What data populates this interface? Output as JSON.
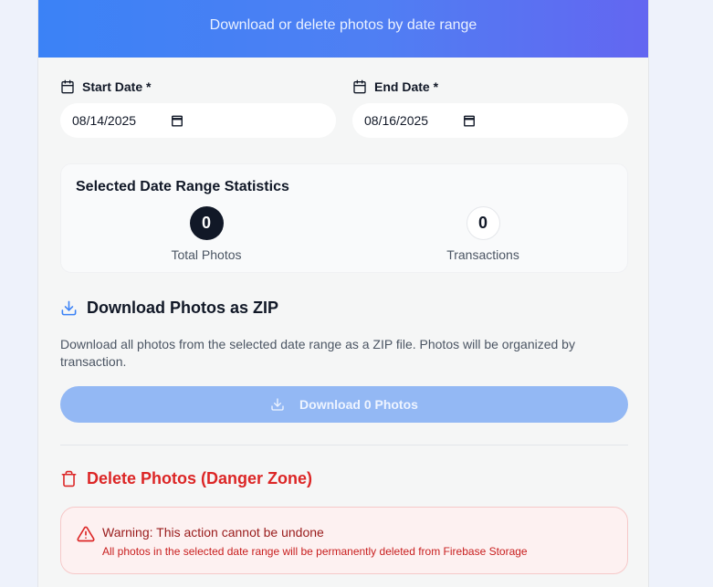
{
  "header": {
    "subtitle": "Download or delete photos by date range"
  },
  "dates": {
    "start": {
      "label": "Start Date *",
      "value": "08/14/2025"
    },
    "end": {
      "label": "End Date *",
      "value": "08/16/2025"
    }
  },
  "stats": {
    "title": "Selected Date Range Statistics",
    "total_photos": {
      "value": "0",
      "label": "Total Photos"
    },
    "transactions": {
      "value": "0",
      "label": "Transactions"
    }
  },
  "download": {
    "title": "Download Photos as ZIP",
    "description": "Download all photos from the selected date range as a ZIP file. Photos will be organized by transaction.",
    "button_label": "Download 0 Photos"
  },
  "delete": {
    "title": "Delete Photos (Danger Zone)",
    "warning_title": "Warning: This action cannot be undone",
    "warning_body": "All photos in the selected date range will be permanently deleted from Firebase Storage"
  },
  "colors": {
    "accent_blue": "#3b82f6",
    "accent_indigo": "#6366f1",
    "danger": "#dc2626",
    "disabled_button": "#93b8f4"
  },
  "icons": [
    "calendar-icon",
    "download-icon",
    "trash-icon",
    "warning-triangle-icon"
  ]
}
